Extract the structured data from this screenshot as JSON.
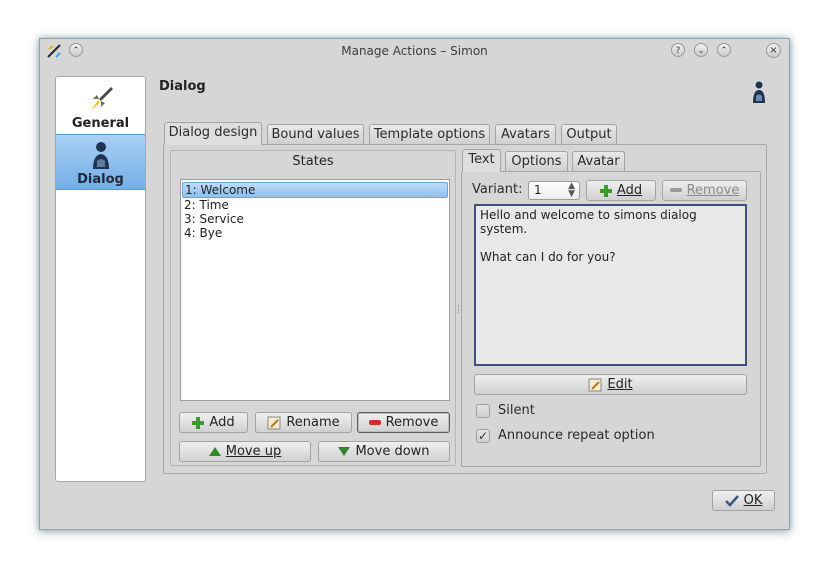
{
  "window": {
    "title": "Manage Actions – Simon",
    "buttons": {
      "help": "?",
      "minimize": "⌄",
      "maximize": "⌃",
      "close": "×"
    }
  },
  "sidebar": {
    "items": [
      {
        "label": "General",
        "icon": "rocket-icon"
      },
      {
        "label": "Dialog",
        "icon": "person-icon"
      }
    ]
  },
  "page": {
    "heading": "Dialog"
  },
  "main_tabs": [
    {
      "label": "Dialog design",
      "active": true
    },
    {
      "label": "Bound values"
    },
    {
      "label": "Template options"
    },
    {
      "label": "Avatars"
    },
    {
      "label": "Output"
    }
  ],
  "states": {
    "title": "States",
    "items": [
      "1: Welcome",
      "2: Time",
      "3: Service",
      "4: Bye"
    ],
    "selected_index": 0,
    "buttons": {
      "add": "Add",
      "rename": "Rename",
      "remove": "Remove",
      "move_up": "Move up",
      "move_down": "Move down"
    }
  },
  "detail_tabs": [
    {
      "label": "Text",
      "active": true
    },
    {
      "label": "Options"
    },
    {
      "label": "Avatar"
    }
  ],
  "text_tab": {
    "variant_label": "Variant:",
    "variant_value": "1",
    "add_label": "Add",
    "remove_label": "Remove",
    "text": "Hello and welcome to simons dialog\nsystem.\n\nWhat can I do for you?",
    "edit_label": "Edit",
    "silent_label": "Silent",
    "silent_checked": false,
    "announce_label": "Announce repeat option",
    "announce_checked": true
  },
  "footer": {
    "ok_label": "OK"
  },
  "colors": {
    "selection": "#8fc0ec",
    "window_bg": "#d6d6d6",
    "text_border": "#3d4f7a"
  }
}
